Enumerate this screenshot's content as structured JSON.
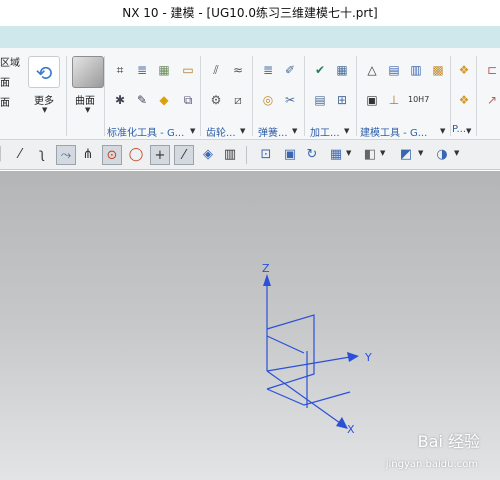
{
  "window": {
    "title": "NX 10 - 建模 - [UG10.0练习三维建模七十.prt]"
  },
  "colors": {
    "accent_bar": "#cfe8ec",
    "axis": "#2b50d8",
    "group_label": "#2d5fa8"
  },
  "ribbon": {
    "left_partial_labels": [
      "区域",
      "面",
      "面"
    ],
    "more_label": "更多",
    "surface_label": "曲面",
    "groups": {
      "standardized_tools": "标准化工具 - G...",
      "gear": "齿轮...",
      "spring": "弹簧...",
      "machining": "加工...",
      "modeling_tools": "建模工具 - G...",
      "last": "P..."
    },
    "icons": [
      "sync-icon",
      "surface-icon",
      "coordinate-icon",
      "gear-tool-icon",
      "spring-tool-icon",
      "weld-icon"
    ]
  },
  "toolbar": {
    "icons": [
      "line-icon",
      "curve-icon",
      "point-set-icon",
      "intersection-icon",
      "circle-snap-icon",
      "circle-center-icon",
      "plus-icon",
      "slash-icon",
      "layer-icon",
      "grid-icon",
      "camera-icon",
      "view-icon",
      "refresh-icon",
      "table-view-icon",
      "shade-icon",
      "cube-icon",
      "hide-icon"
    ]
  },
  "viewport": {
    "axes": {
      "z": "Z",
      "y": "Y",
      "x": "X"
    }
  },
  "watermark": {
    "brand": "Bai 经验",
    "url": "jingyan.baidu.com"
  }
}
